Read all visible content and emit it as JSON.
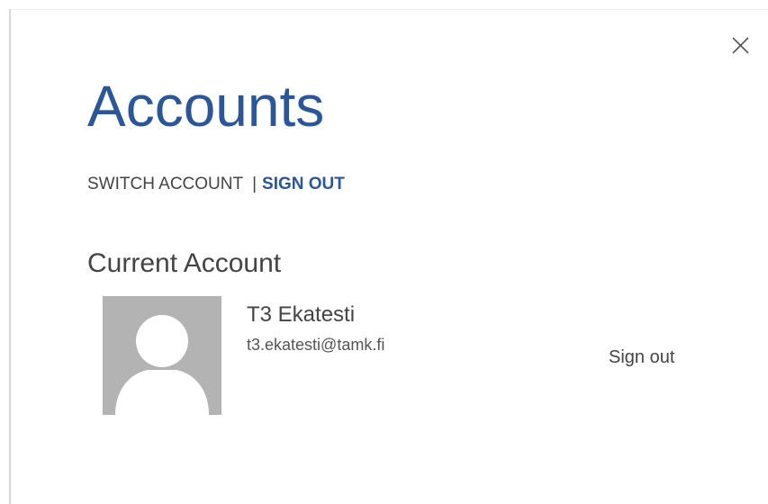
{
  "dialog": {
    "title": "Accounts",
    "close_icon": "close-icon"
  },
  "account_actions": {
    "switch_label": "SWITCH ACCOUNT",
    "divider": "|",
    "signout_label": "SIGN OUT"
  },
  "current_account": {
    "section_title": "Current Account",
    "avatar_icon": "default-user-avatar-icon",
    "name": "T3 Ekatesti",
    "email": "t3.ekatesti@tamk.fi",
    "signout_button": "Sign out"
  },
  "colors": {
    "accent": "#2b579a",
    "text": "#444444",
    "avatar_bg": "#b3b3b3",
    "avatar_fg": "#ffffff"
  }
}
